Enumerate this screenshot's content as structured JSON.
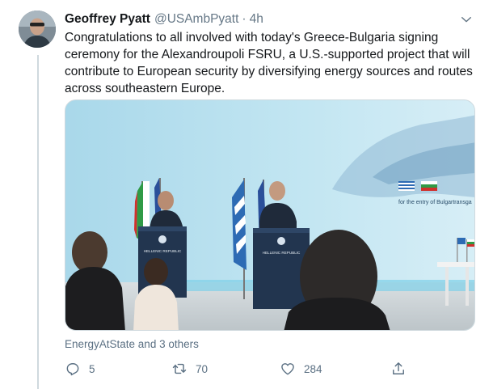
{
  "tweet": {
    "display_name": "Geoffrey Pyatt",
    "handle": "@USAmbPyatt",
    "separator": "·",
    "time": "4h",
    "text": "Congratulations to all involved with today's Greece-Bulgaria signing ceremony for the Alexandroupoli FSRU, a U.S.-supported project that will contribute to European security by diversifying energy sources and routes across southeastern Europe."
  },
  "media": {
    "podium_left_label": "HELLENIC REPUBLIC",
    "podium_right_label": "HELLENIC REPUBLIC",
    "backdrop_caption": "for the entry of Bulgartransga"
  },
  "likers": "EnergyAtState and 3 others",
  "actions": {
    "reply_count": "5",
    "retweet_count": "70",
    "like_count": "284"
  },
  "icons": {
    "chevron": "chevron-down-icon",
    "reply": "reply-icon",
    "retweet": "retweet-icon",
    "like": "heart-icon",
    "share": "share-icon"
  },
  "colors": {
    "text_primary": "#14171a",
    "text_secondary": "#5b7083",
    "border": "#cfd9de"
  }
}
